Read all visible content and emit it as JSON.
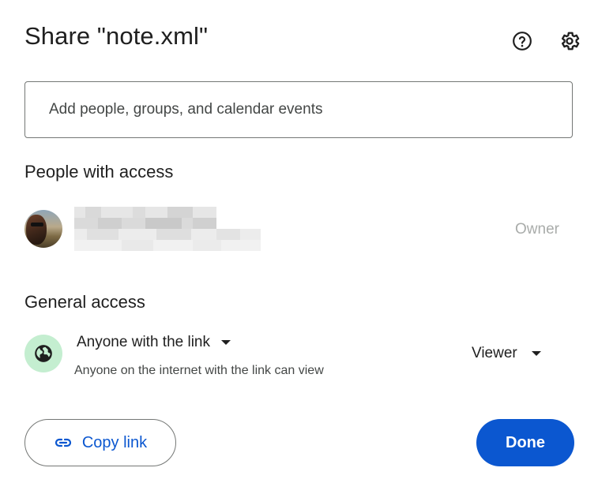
{
  "dialog": {
    "title": "Share \"note.xml\"",
    "help_icon": "help-circle-icon",
    "settings_icon": "gear-icon"
  },
  "add_people": {
    "placeholder": "Add people, groups, and calendar events"
  },
  "people_with_access": {
    "heading": "People with access",
    "people": [
      {
        "role": "Owner",
        "name_redacted": true,
        "avatar": "user-photo"
      }
    ]
  },
  "general_access": {
    "heading": "General access",
    "icon": "globe-icon",
    "scope_label": "Anyone with the link",
    "description": "Anyone on the internet with the link can view",
    "role_label": "Viewer"
  },
  "footer": {
    "copy_link_label": "Copy link",
    "copy_link_icon": "link-icon",
    "done_label": "Done"
  },
  "colors": {
    "primary": "#0b57d0",
    "globe_bg": "#c4eed0",
    "border": "#747775",
    "muted_text": "#a9acaa"
  }
}
